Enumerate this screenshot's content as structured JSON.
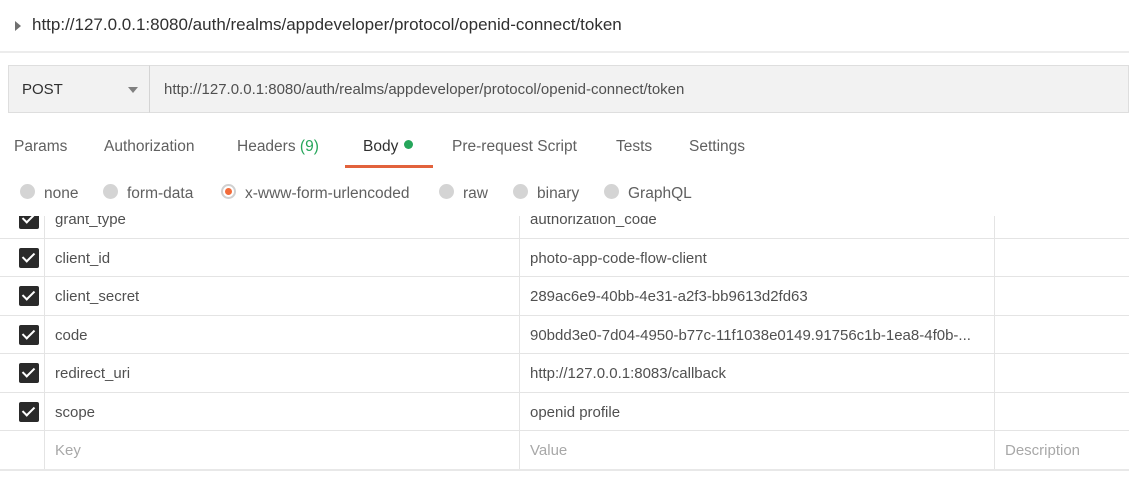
{
  "request": {
    "title": "http://127.0.0.1:8080/auth/realms/appdeveloper/protocol/openid-connect/token",
    "method": "POST",
    "url": "http://127.0.0.1:8080/auth/realms/appdeveloper/protocol/openid-connect/token"
  },
  "tabs": {
    "params": "Params",
    "authorization": "Authorization",
    "headers": "Headers",
    "headers_count": "(9)",
    "body": "Body",
    "prerequest": "Pre-request Script",
    "tests": "Tests",
    "settings": "Settings",
    "active": "Body",
    "accent_color": "#e2623c",
    "indicator_color": "#26a65b"
  },
  "body_types": {
    "none": "none",
    "form_data": "form-data",
    "urlencoded": "x-www-form-urlencoded",
    "raw": "raw",
    "binary": "binary",
    "graphql": "GraphQL",
    "selected": "x-www-form-urlencoded"
  },
  "params": [
    {
      "checked": true,
      "key": "grant_type",
      "value": "authorization_code",
      "description": ""
    },
    {
      "checked": true,
      "key": "client_id",
      "value": "photo-app-code-flow-client",
      "description": ""
    },
    {
      "checked": true,
      "key": "client_secret",
      "value": "289ac6e9-40bb-4e31-a2f3-bb9613d2fd63",
      "description": ""
    },
    {
      "checked": true,
      "key": "code",
      "value": "90bdd3e0-7d04-4950-b77c-11f1038e0149.91756c1b-1ea8-4f0b-...",
      "description": ""
    },
    {
      "checked": true,
      "key": "redirect_uri",
      "value": "http://127.0.0.1:8083/callback",
      "description": ""
    },
    {
      "checked": true,
      "key": "scope",
      "value": "openid profile",
      "description": ""
    }
  ],
  "placeholders": {
    "key": "Key",
    "value": "Value",
    "description": "Description"
  }
}
